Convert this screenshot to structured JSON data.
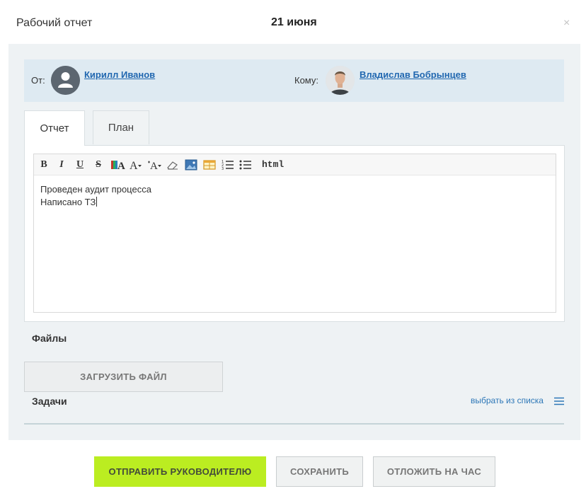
{
  "header": {
    "title": "Рабочий отчет",
    "date": "21 июня",
    "close_symbol": "×"
  },
  "participants": {
    "from_label": "От:",
    "from_name": "Кирилл Иванов",
    "to_label": "Кому:",
    "to_name": "Владислав Бобрынцев"
  },
  "tabs": [
    {
      "label": "Отчет",
      "active": true
    },
    {
      "label": "План",
      "active": false
    }
  ],
  "editor": {
    "toolbar": {
      "bold": "B",
      "italic": "I",
      "underline": "U",
      "strike": "S",
      "html": "html"
    },
    "lines": [
      "Проведен аудит процесса",
      "Написано ТЗ"
    ]
  },
  "files": {
    "label": "Файлы",
    "upload_button": "ЗАГРУЗИТЬ ФАЙЛ"
  },
  "tasks": {
    "label": "Задачи",
    "choose_link": "выбрать из списка"
  },
  "footer": {
    "send_button": "ОТПРАВИТЬ РУКОВОДИТЕЛЮ",
    "save_button": "СОХРАНИТЬ",
    "postpone_button": "ОТЛОЖИТЬ НА ЧАС"
  },
  "colors": {
    "accent_green": "#bbed21",
    "link_blue": "#2067b0",
    "participants_bg": "#deeaf2"
  }
}
